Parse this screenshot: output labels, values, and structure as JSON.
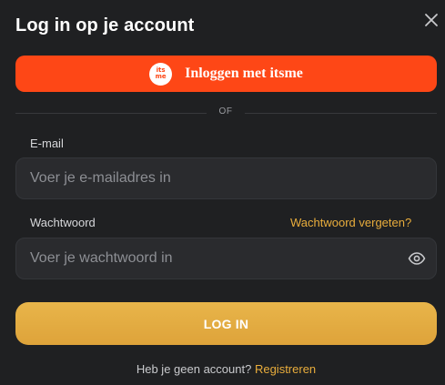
{
  "dialog": {
    "title": "Log in op je account",
    "close_icon": "close-icon"
  },
  "itsme": {
    "logo_top": "its",
    "logo_bottom": "me",
    "label": "Inloggen met itsme",
    "color": "#fe4716"
  },
  "divider": {
    "label": "OF"
  },
  "email": {
    "label": "E-mail",
    "placeholder": "Voer je e-mailadres in",
    "value": ""
  },
  "password": {
    "label": "Wachtwoord",
    "forgot_label": "Wachtwoord vergeten?",
    "placeholder": "Voer je wachtwoord in",
    "value": "",
    "toggle_icon": "eye-icon"
  },
  "login": {
    "label": "LOG IN",
    "color": "#e3ad43"
  },
  "footer": {
    "text": "Heb je geen account?",
    "link_label": "Registreren",
    "link_color": "#e9ad3c"
  }
}
